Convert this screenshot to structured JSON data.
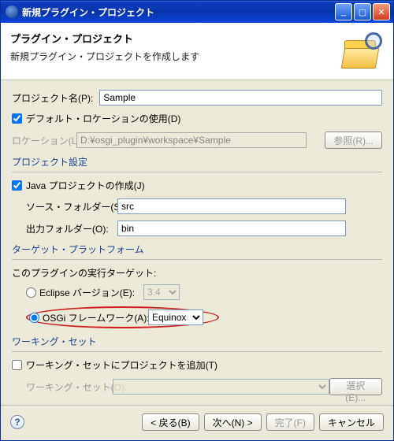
{
  "window": {
    "title": "新規プラグイン・プロジェクト"
  },
  "header": {
    "title": "プラグイン・プロジェクト",
    "subtitle": "新規プラグイン・プロジェクトを作成します"
  },
  "project": {
    "name_label": "プロジェクト名(P):",
    "name_value": "Sample"
  },
  "location": {
    "use_default_label": "デフォルト・ロケーションの使用(D)",
    "loc_label": "ロケーション(L):",
    "loc_value": "D:¥osgi_plugin¥workspace¥Sample",
    "browse_btn": "参照(R)..."
  },
  "project_settings": {
    "group_title": "プロジェクト設定",
    "create_java_label": "Java プロジェクトの作成(J)",
    "src_label": "ソース・フォルダー(S):",
    "src_value": "src",
    "out_label": "出力フォルダー(O):",
    "out_value": "bin"
  },
  "target": {
    "group_title": "ターゲット・プラットフォーム",
    "runtime_label": "このプラグインの実行ターゲット:",
    "eclipse_label": "Eclipse バージョン(E):",
    "eclipse_value": "3.4",
    "osgi_label": "OSGi フレームワーク(A):",
    "osgi_value": "Equinox"
  },
  "working_set": {
    "group_title": "ワーキング・セット",
    "add_label": "ワーキング・セットにプロジェクトを追加(T)",
    "ws_label": "ワーキング・セット(O):",
    "select_btn": "選択(E)..."
  },
  "footer": {
    "back": "< 戻る(B)",
    "next": "次へ(N) >",
    "finish": "完了(F)",
    "cancel": "キャンセル"
  }
}
